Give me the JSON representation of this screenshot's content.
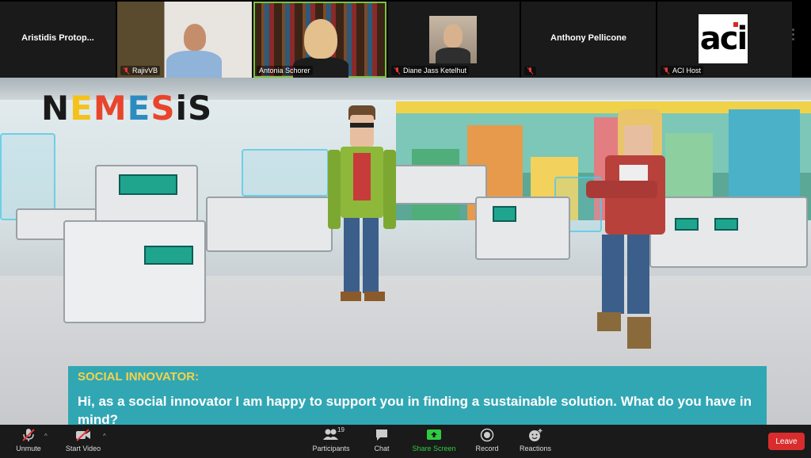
{
  "participants_strip": {
    "tiles": [
      {
        "name": "Aristidis  Protop...",
        "muted": false,
        "video": false
      },
      {
        "name": "RajivVB",
        "muted": true,
        "video": true
      },
      {
        "name": "Antonia Schorer",
        "muted": false,
        "video": true,
        "active_speaker": true
      },
      {
        "name": "Diane Jass Ketelhut",
        "muted": true,
        "video": true
      },
      {
        "name": "Anthony Pellicone",
        "muted": true,
        "video": false
      },
      {
        "name": "ACI Host",
        "muted": true,
        "video": false,
        "logo_text": "aci"
      }
    ]
  },
  "game": {
    "logo_letters": [
      "N",
      "E",
      "M",
      "E",
      "S",
      "i",
      "S"
    ],
    "dialog": {
      "speaker": "SOCIAL INNOVATOR:",
      "text": "Hi, as a social innovator I am happy to support you in finding a sustainable solution. What do you have in mind?"
    }
  },
  "toolbar": {
    "unmute": "Unmute",
    "start_video": "Start Video",
    "participants": "Participants",
    "participants_count": "19",
    "chat": "Chat",
    "share_screen": "Share Screen",
    "record": "Record",
    "reactions": "Reactions",
    "leave": "Leave"
  },
  "colors": {
    "accent_green": "#2ecc40",
    "leave_red": "#d92d2d",
    "dialog_teal": "#31a7b4",
    "speaker_yellow": "#f6d24a"
  }
}
